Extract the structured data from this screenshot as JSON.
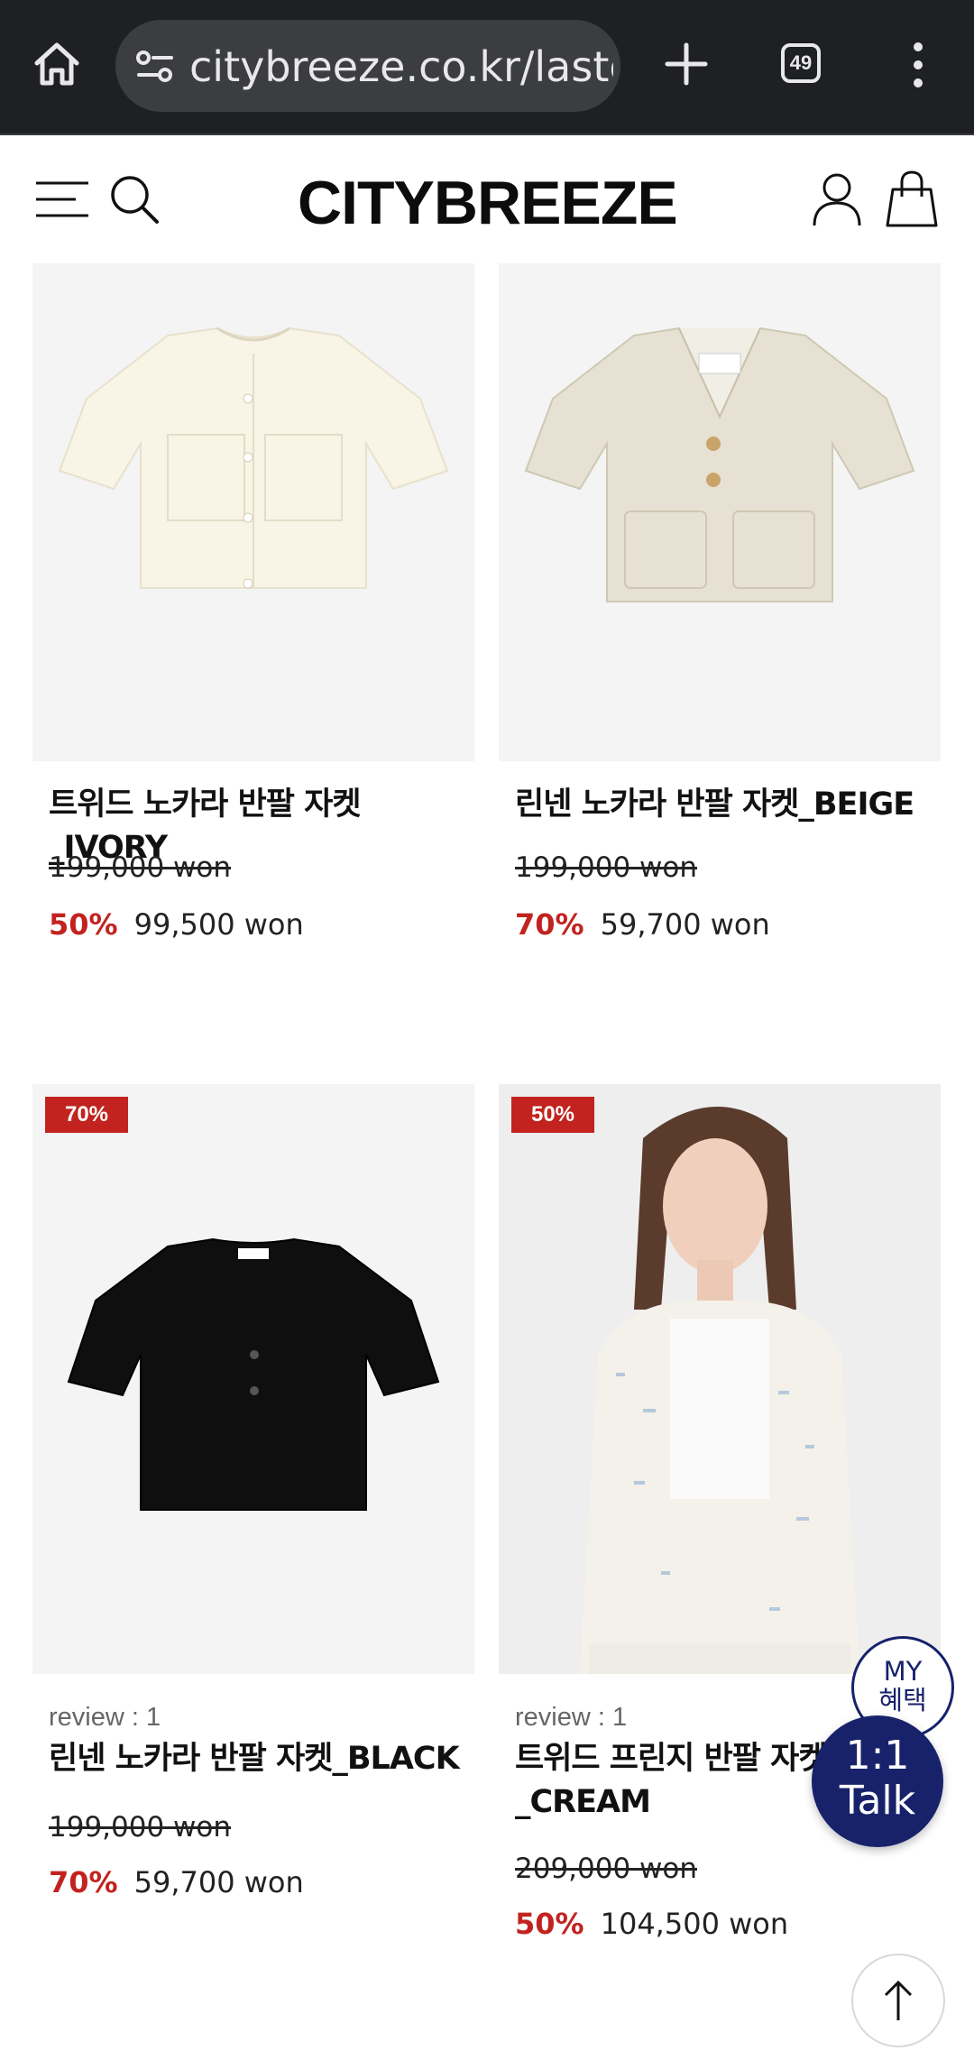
{
  "browser": {
    "url": "citybreeze.co.kr/lastc",
    "tab_count": "49",
    "icons": [
      "home-icon",
      "site-settings-icon",
      "new-tab-icon",
      "tab-switcher-icon",
      "more-menu-icon"
    ]
  },
  "header": {
    "logo": "CITYBREEZE",
    "icons": [
      "hamburger-menu-icon",
      "search-icon",
      "user-icon",
      "shopping-bag-icon"
    ]
  },
  "colors": {
    "sale_red": "#c2231f",
    "navy": "#17226b",
    "browser_bg": "#1f2023"
  },
  "products": [
    {
      "name": "트위드 노카라 반팔 자켓_IVORY",
      "review": "",
      "badge": "",
      "original_price": "199,000 won",
      "discount": "50%",
      "sale_price": "99,500 won"
    },
    {
      "name": "린넨 노카라 반팔 자켓_BEIGE",
      "review": "",
      "badge": "",
      "original_price": "199,000 won",
      "discount": "70%",
      "sale_price": "59,700 won"
    },
    {
      "name": "린넨 노카라 반팔 자켓_BLACK",
      "review": "review : 1",
      "badge": "70%",
      "original_price": "199,000 won",
      "discount": "70%",
      "sale_price": "59,700 won"
    },
    {
      "name_line1": "트위드 프린지 반팔 자켓",
      "name_line2": "_CREAM",
      "review": "review : 1",
      "badge": "50%",
      "original_price": "209,000 won",
      "discount": "50%",
      "sale_price": "104,500 won"
    }
  ],
  "floating": {
    "my_benefit_line1": "MY",
    "my_benefit_line2": "혜택",
    "talk_line1": "1:1",
    "talk_line2": "Talk"
  }
}
